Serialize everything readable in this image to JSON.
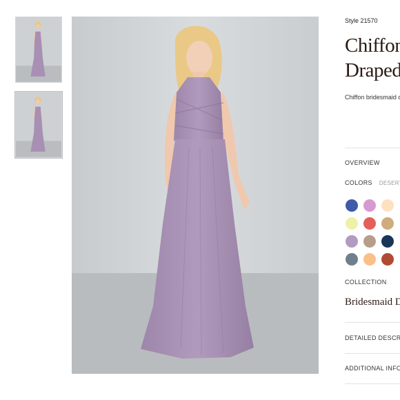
{
  "thumbnails": [
    {
      "label": "dress-front-thumbnail-1"
    },
    {
      "label": "dress-front-thumbnail-2"
    }
  ],
  "product": {
    "style": "Style 21570",
    "title_line1": "Chiffon",
    "title_line2": "Draped",
    "description": "Chiffon bridesmaid d"
  },
  "sections": {
    "overview": "OVERVIEW",
    "colors": "COLORS",
    "colors_tab2": "DESERT",
    "collection": "COLLECTION",
    "collection_name": "Bridesmaid D",
    "detailed_description": "DETAILED DESCRI",
    "additional_info": "ADDITIONAL INFO"
  },
  "swatches": [
    {
      "name": "royal-blue",
      "color": "#3e5aa8"
    },
    {
      "name": "orchid",
      "color": "#d79ad0"
    },
    {
      "name": "peach",
      "color": "#fde1c0"
    },
    {
      "name": "lemon",
      "color": "#eef2a8"
    },
    {
      "name": "coral",
      "color": "#e3605a"
    },
    {
      "name": "camel",
      "color": "#d0ab7e"
    },
    {
      "name": "lilac",
      "color": "#b29ac0"
    },
    {
      "name": "taupe",
      "color": "#b89e8a"
    },
    {
      "name": "navy",
      "color": "#193659"
    },
    {
      "name": "slate",
      "color": "#6f7f8b"
    },
    {
      "name": "apricot",
      "color": "#fbbf8a"
    },
    {
      "name": "rust",
      "color": "#b14a35"
    }
  ],
  "colors": {
    "dress": "#a992b5",
    "background": "#cfd3d5",
    "floor": "#b9bcbe",
    "hair": "#e9c985",
    "skin": "#f1cdb5"
  }
}
